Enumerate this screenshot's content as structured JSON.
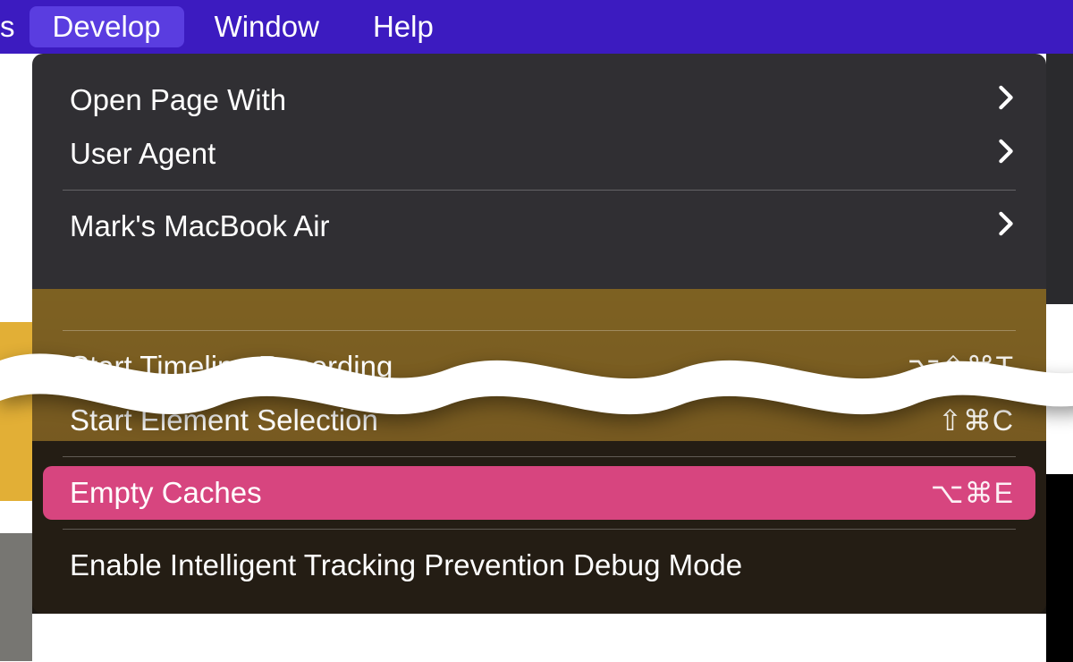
{
  "menubar": {
    "fragment": "s",
    "items": [
      {
        "label": "Develop",
        "active": true
      },
      {
        "label": "Window",
        "active": false
      },
      {
        "label": "Help",
        "active": false
      }
    ]
  },
  "dropdown": {
    "top_group1": [
      {
        "label": "Open Page With",
        "hasSubmenu": true
      },
      {
        "label": "User Agent",
        "hasSubmenu": true
      }
    ],
    "top_group2": [
      {
        "label": "Mark's MacBook Air",
        "hasSubmenu": true
      }
    ],
    "bottom_group1": [
      {
        "label": "Start Timeline Recording",
        "shortcut": "⌥⇧⌘T"
      },
      {
        "label": "Start Element Selection",
        "shortcut": "⇧⌘C"
      }
    ],
    "bottom_group2": [
      {
        "label": "Empty Caches",
        "shortcut": "⌥⌘E",
        "highlighted": true
      }
    ],
    "bottom_group3": [
      {
        "label": "Enable Intelligent Tracking Prevention Debug Mode"
      }
    ]
  }
}
